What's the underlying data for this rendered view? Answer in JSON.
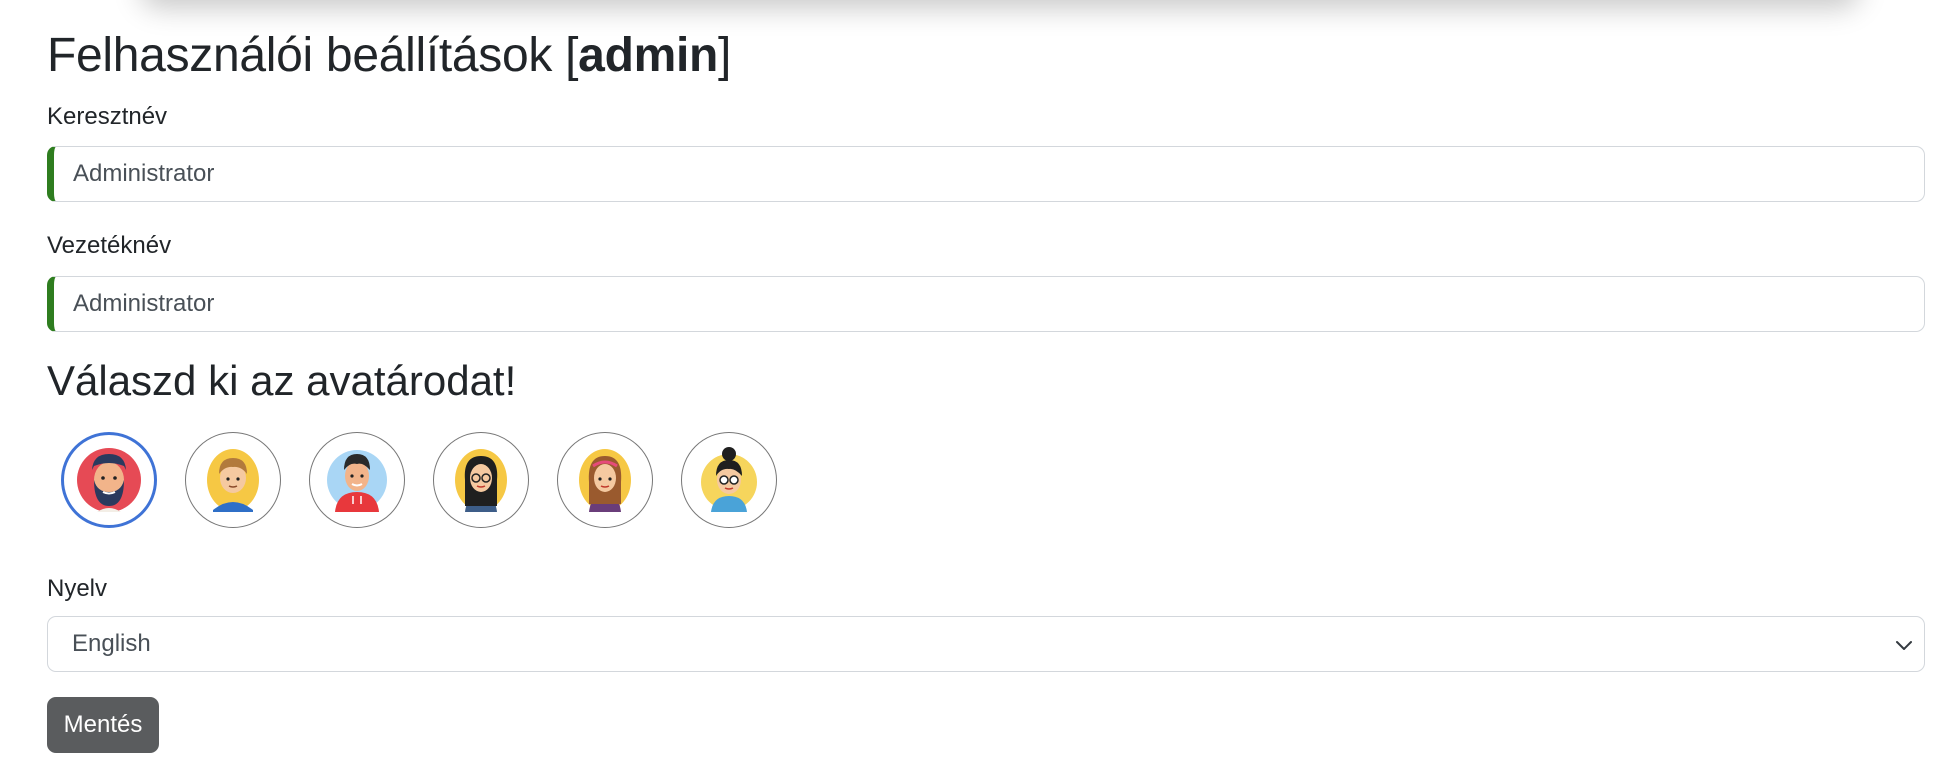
{
  "header": {
    "title_prefix": "Felhasználói beállítások [",
    "username": "admin",
    "title_suffix": "]"
  },
  "form": {
    "first_name": {
      "label": "Keresztnév",
      "value": "Administrator"
    },
    "last_name": {
      "label": "Vezetéknév",
      "value": "Administrator"
    },
    "avatar_section": {
      "title": "Válaszd ki az avatárodat!",
      "avatars": [
        {
          "name": "bearded-man-avatar",
          "selected": true
        },
        {
          "name": "blond-boy-avatar",
          "selected": false
        },
        {
          "name": "red-hoodie-man-avatar",
          "selected": false
        },
        {
          "name": "glasses-woman-avatar",
          "selected": false
        },
        {
          "name": "headband-girl-avatar",
          "selected": false
        },
        {
          "name": "bun-glasses-woman-avatar",
          "selected": false
        }
      ]
    },
    "language": {
      "label": "Nyelv",
      "selected": "English"
    },
    "save_label": "Mentés"
  },
  "colors": {
    "valid_border": "#2e7d1f",
    "selected_avatar_border": "#3f73d6",
    "save_button_bg": "#5a5c5e"
  }
}
